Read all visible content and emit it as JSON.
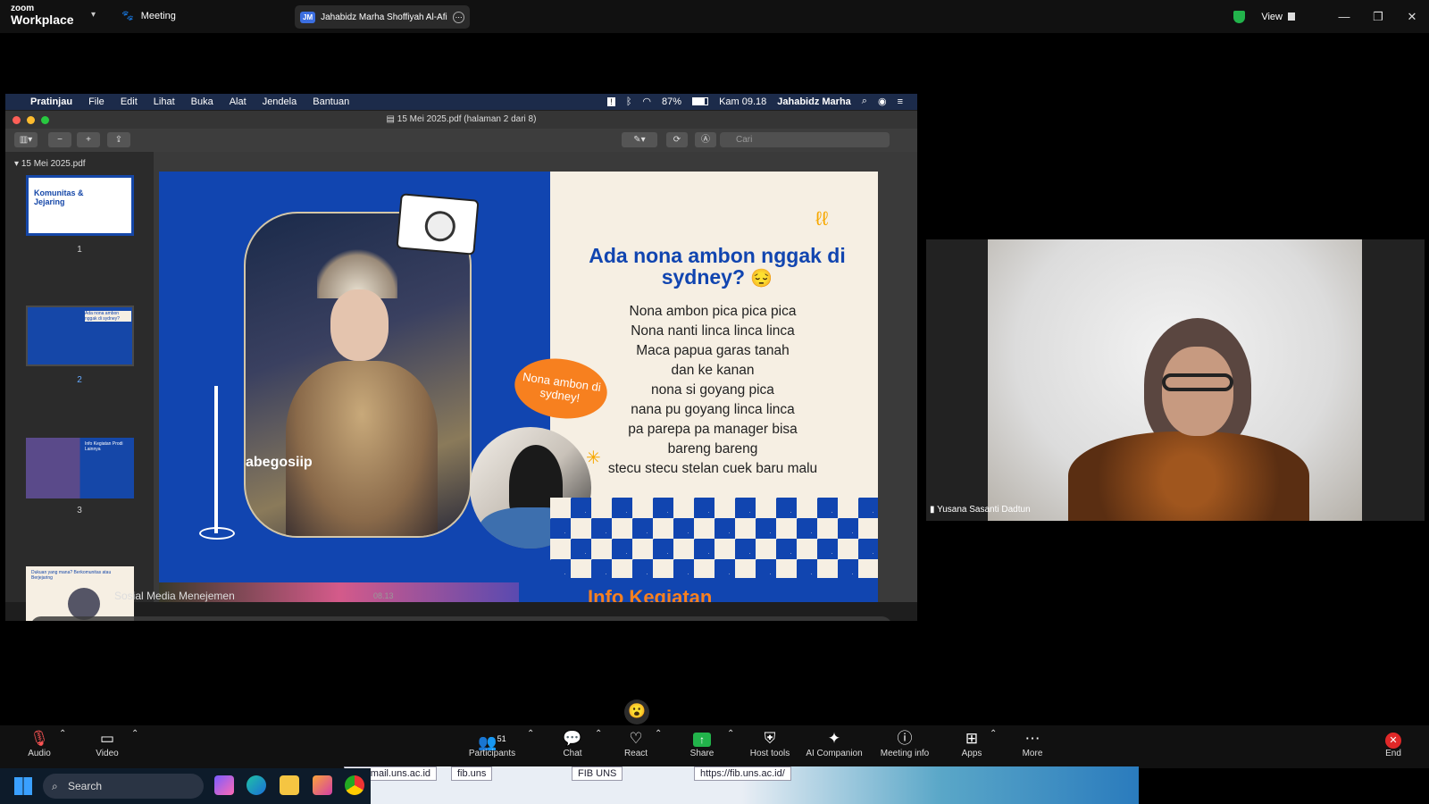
{
  "zoom_top": {
    "logo_line1": "zoom",
    "logo_line2": "Workplace",
    "meeting_label": "Meeting",
    "speaker_initials": "JM",
    "speaker_name": "Jahabidz Marha Shoffiyah Al-Afiz",
    "view_label": "View"
  },
  "mac_menu": {
    "items": [
      "Pratinjau",
      "File",
      "Edit",
      "Lihat",
      "Buka",
      "Alat",
      "Jendela",
      "Bantuan"
    ],
    "battery": "87%",
    "clock": "Kam 09.18",
    "user": "Jahabidz Marha"
  },
  "preview": {
    "window_title": "15 Mei 2025.pdf (halaman 2 dari 8)",
    "search_placeholder": "Cari",
    "sidebar_file": "15 Mei 2025.pdf",
    "thumbs": [
      {
        "num": "1",
        "text": "Komunitas & Jejaring"
      },
      {
        "num": "2",
        "text": "Ada nona ambon nggak di sydney?"
      },
      {
        "num": "3",
        "text": "Info Kegiatan Prodi Lainnya"
      },
      {
        "text": "Dukuan yang mana? Berkomunitas atau Berjejaring"
      }
    ]
  },
  "slide": {
    "heading": "Ada nona ambon nggak di sydney?",
    "bubble": "Nona ambon di sydney!",
    "watermark": "abegosiip",
    "lyrics": [
      "Nona ambon pica pica pica",
      "Nona nanti linca linca linca",
      "Maca papua garas tanah",
      "dan ke kanan",
      "nona si goyang pica",
      "nana pu goyang linca linca",
      "pa parepa pa manager bisa",
      "bareng bareng",
      "stecu stecu stelan cuek baru malu"
    ],
    "next_slide_title": "Info Kegiatan"
  },
  "notification": {
    "title": "Sosial Media Menejemen",
    "time": "08.13"
  },
  "participant": {
    "name": "Yusana Sasanti Dadtun"
  },
  "toolbar": {
    "audio": "Audio",
    "video": "Video",
    "participants": "Participants",
    "participants_count": "51",
    "chat": "Chat",
    "react": "React",
    "share": "Share",
    "host_tools": "Host tools",
    "ai_companion": "AI Companion",
    "meeting_info": "Meeting info",
    "apps": "Apps",
    "more": "More",
    "end": "End"
  },
  "taskbar": {
    "search": "Search",
    "bg_tabs": [
      "fib@mail.uns.ac.id",
      "fib.uns",
      "FIB UNS",
      "https://fib.uns.ac.id/"
    ]
  },
  "colors": {
    "slide_blue": "#1145b0",
    "slide_cream": "#f6efe3",
    "accent_orange": "#f7801f",
    "share_green": "#22b34b",
    "end_red": "#e02828"
  }
}
